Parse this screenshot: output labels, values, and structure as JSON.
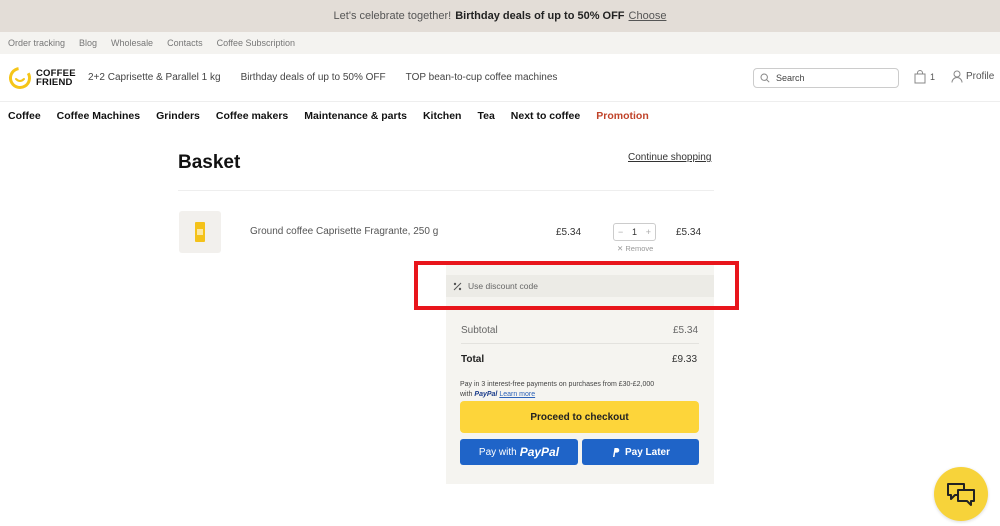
{
  "promo_bar": {
    "lead": "Let's celebrate together!",
    "deal": "Birthday deals of up to 50% OFF",
    "link": "Choose"
  },
  "utility_links": [
    "Order tracking",
    "Blog",
    "Wholesale",
    "Contacts",
    "Coffee Subscription"
  ],
  "header": {
    "logo_line1": "COFFEE",
    "logo_line2": "FRIEND",
    "links": [
      "2+2 Caprisette & Parallel 1 kg",
      "Birthday deals of up to 50% OFF",
      "TOP bean-to-cup coffee machines"
    ],
    "search_placeholder": "Search",
    "basket_count": "1",
    "profile_label": "Profile"
  },
  "nav": [
    "Coffee",
    "Coffee Machines",
    "Grinders",
    "Coffee makers",
    "Maintenance & parts",
    "Kitchen",
    "Tea",
    "Next to coffee",
    "Promotion"
  ],
  "basket": {
    "title": "Basket",
    "continue_label": "Continue shopping",
    "item": {
      "name": "Ground coffee Caprisette Fragrante, 250 g",
      "price": "£5.34",
      "quantity": "1",
      "minus": "−",
      "plus": "+",
      "remove_label": "✕ Remove",
      "line_total": "£5.34"
    }
  },
  "summary": {
    "discount_label": "Use discount code",
    "subtotal_label": "Subtotal",
    "subtotal_value": "£5.34",
    "total_label": "Total",
    "total_value": "£9.33",
    "paypal_note": "Pay in 3 interest-free payments on purchases from £30-£2,000",
    "paypal_note_with": "with",
    "paypal_note_brand": "PayPal",
    "learn_more": "Learn more",
    "checkout_label": "Proceed to checkout",
    "paypal_btn_prefix": "Pay with",
    "paypal_btn_brand": "PayPal",
    "paylater_label": "Pay Later"
  },
  "colors": {
    "accent_yellow": "#fdd53a",
    "paypal_blue": "#1f64c8",
    "promotion_red": "#c0432a",
    "highlight_red": "#e8151b"
  }
}
